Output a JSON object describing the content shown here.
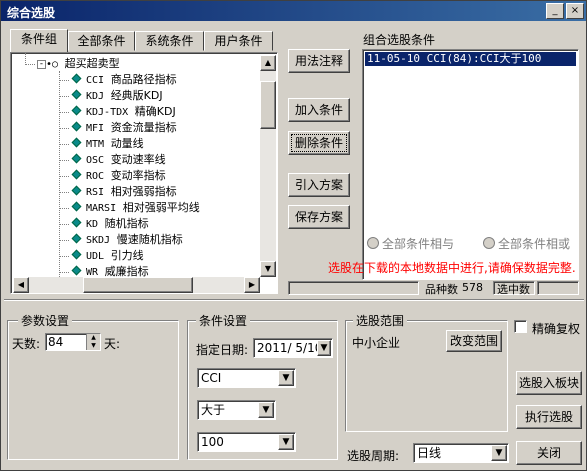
{
  "window": {
    "title": "综合选股",
    "minimize_glyph": "_",
    "close_glyph": "×"
  },
  "tabs": [
    {
      "label": "条件组"
    },
    {
      "label": "全部条件"
    },
    {
      "label": "系统条件"
    },
    {
      "label": "用户条件"
    }
  ],
  "tree": {
    "group_label": "超买超卖型",
    "items": [
      {
        "code": "CCI",
        "name": "商品路径指标"
      },
      {
        "code": "KDJ",
        "name": "经典版KDJ"
      },
      {
        "code": "KDJ-TDX",
        "name": "精确KDJ"
      },
      {
        "code": "MFI",
        "name": "资金流量指标"
      },
      {
        "code": "MTM",
        "name": "动量线"
      },
      {
        "code": "OSC",
        "name": "变动速率线"
      },
      {
        "code": "ROC",
        "name": "变动率指标"
      },
      {
        "code": "RSI",
        "name": "相对强弱指标"
      },
      {
        "code": "MARSI",
        "name": "相对强弱平均线"
      },
      {
        "code": "KD",
        "name": "随机指标"
      },
      {
        "code": "SKDJ",
        "name": "慢速随机指标"
      },
      {
        "code": "UDL",
        "name": "引力线"
      },
      {
        "code": "WR",
        "name": "威廉指标"
      }
    ]
  },
  "buttons": {
    "usage": "用法注释",
    "add": "加入条件",
    "delete": "删除条件",
    "import": "引入方案",
    "save": "保存方案",
    "change_scope": "改变范围",
    "to_block": "选股入板块",
    "run": "执行选股",
    "close": "关闭"
  },
  "combo_panel": {
    "title": "组合选股条件",
    "items": [
      "11-05-10 CCI(84):CCI大于100"
    ],
    "radio_and": "全部条件相与",
    "radio_or": "全部条件相或",
    "warning": "选股在下载的本地数据中进行,请确保数据完整.",
    "count_label": "品种数",
    "count_value": "578",
    "selected_label": "选中数",
    "selected_value": ""
  },
  "params": {
    "title": "参数设置",
    "days_label": "天数:",
    "days_value": "84",
    "days_unit": "天:"
  },
  "conditions": {
    "title": "条件设置",
    "date_label": "指定日期:",
    "date_value": "2011/ 5/10",
    "indicator": "CCI",
    "operator": "大于",
    "threshold": "100"
  },
  "scope": {
    "title": "选股范围",
    "value": "中小企业"
  },
  "options": {
    "precise_label": "精确复权",
    "precise_checked": false
  },
  "period": {
    "label": "选股周期:",
    "value": "日线"
  },
  "colors": {
    "warning": "#ff0000",
    "selection": "#0a246a",
    "title_bar": "#0a246a"
  }
}
